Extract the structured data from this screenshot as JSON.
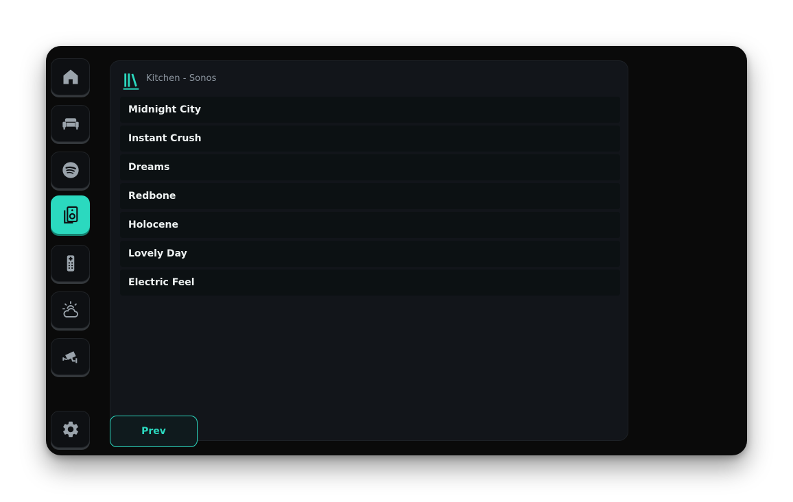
{
  "theme": {
    "accent": "#2bd9bf",
    "icon_color": "#9aa3ab",
    "background": "#0a0a0a",
    "panel": "#12151a"
  },
  "sidebar": {
    "items": [
      {
        "icon": "home-icon",
        "active": false
      },
      {
        "icon": "sofa-icon",
        "active": false
      },
      {
        "icon": "spotify-icon",
        "active": false
      },
      {
        "icon": "speaker-icon",
        "active": true
      },
      {
        "icon": "remote-icon",
        "active": false
      },
      {
        "icon": "weather-icon",
        "active": false
      },
      {
        "icon": "security-camera-icon",
        "active": false
      }
    ],
    "settings": {
      "icon": "gear-icon"
    }
  },
  "player": {
    "title": "Kitchen - Sonos",
    "header_icon": "library-icon"
  },
  "tracks": [
    "Midnight City",
    "Instant Crush",
    "Dreams",
    "Redbone",
    "Holocene",
    "Lovely Day",
    "Electric Feel"
  ],
  "pagination": {
    "prev_label": "Prev"
  }
}
